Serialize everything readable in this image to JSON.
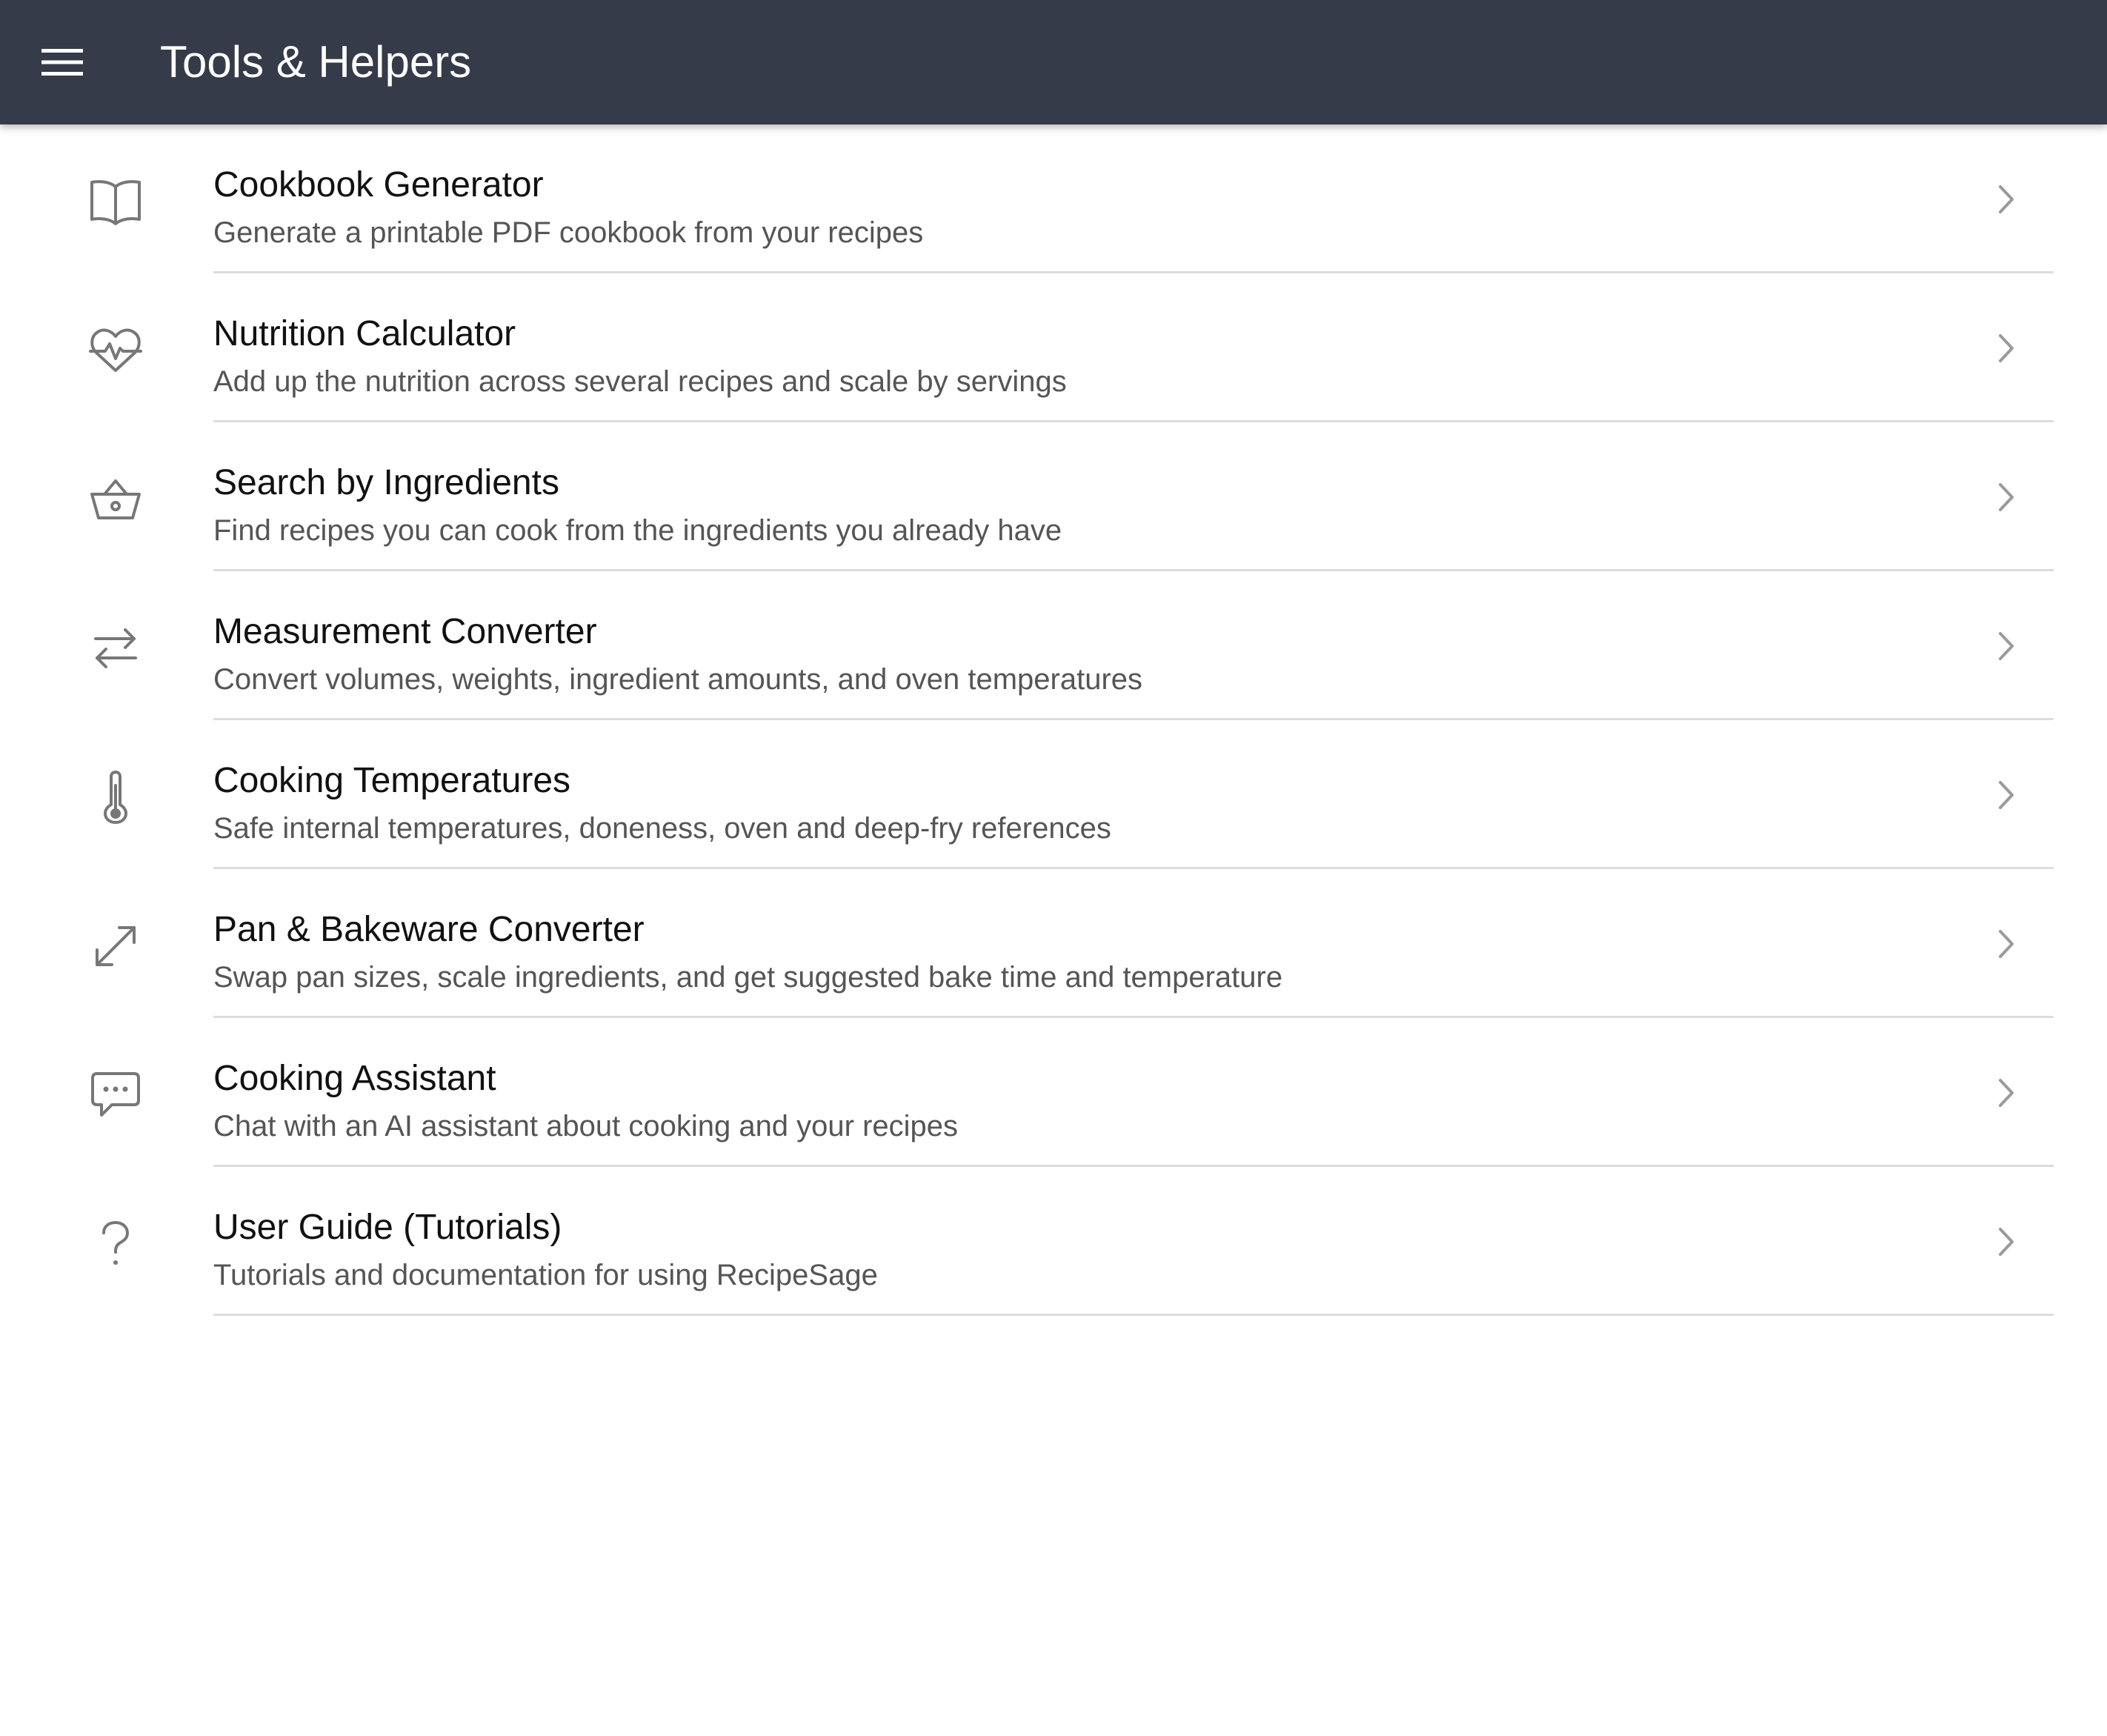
{
  "header": {
    "title": "Tools & Helpers",
    "menu_icon": "menu-icon"
  },
  "colors": {
    "toolbar_background": "#353b48",
    "toolbar_text": "#ffffff",
    "title_text": "#111111",
    "description_text": "#555555",
    "icon": "#777777",
    "divider": "#dcdcdc"
  },
  "tools": {
    "items": [
      {
        "icon": "book-icon",
        "title": "Cookbook Generator",
        "description": "Generate a printable PDF cookbook from your recipes"
      },
      {
        "icon": "heart-pulse-icon",
        "title": "Nutrition Calculator",
        "description": "Add up the nutrition across several recipes and scale by servings"
      },
      {
        "icon": "basket-icon",
        "title": "Search by Ingredients",
        "description": "Find recipes you can cook from the ingredients you already have"
      },
      {
        "icon": "swap-arrows-icon",
        "title": "Measurement Converter",
        "description": "Convert volumes, weights, ingredient amounts, and oven temperatures"
      },
      {
        "icon": "thermometer-icon",
        "title": "Cooking Temperatures",
        "description": "Safe internal temperatures, doneness, oven and deep-fry references"
      },
      {
        "icon": "resize-arrows-icon",
        "title": "Pan & Bakeware Converter",
        "description": "Swap pan sizes, scale ingredients, and get suggested bake time and temperature"
      },
      {
        "icon": "chat-bubble-icon",
        "title": "Cooking Assistant",
        "description": "Chat with an AI assistant about cooking and your recipes"
      },
      {
        "icon": "help-icon",
        "title": "User Guide (Tutorials)",
        "description": "Tutorials and documentation for using RecipeSage"
      }
    ]
  }
}
